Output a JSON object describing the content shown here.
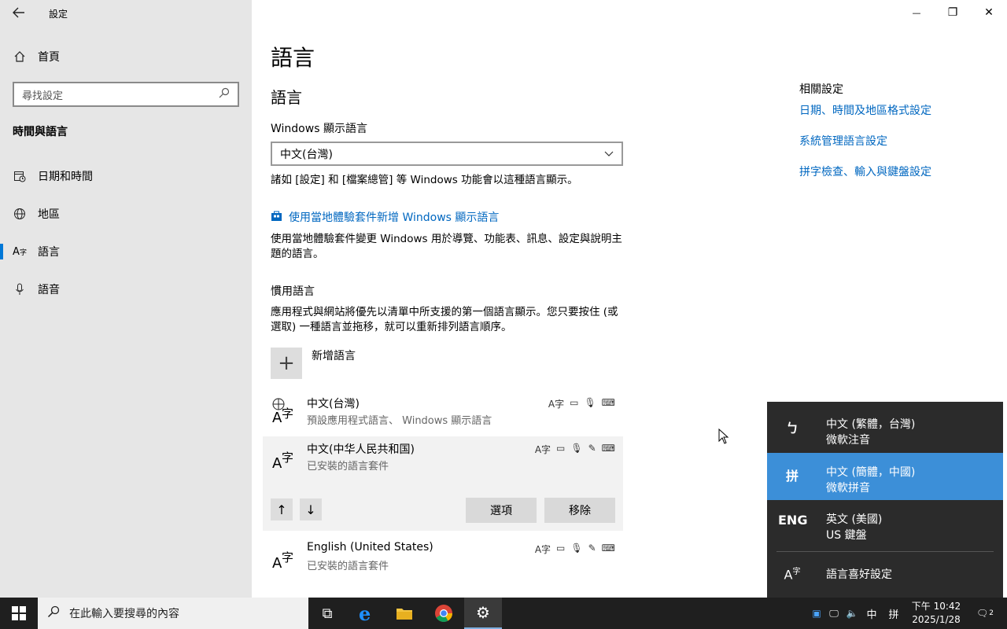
{
  "window": {
    "title": "設定",
    "minimize": "—",
    "restore": "❐",
    "close": "✕"
  },
  "sidebar": {
    "home_label": "首頁",
    "search_placeholder": "尋找設定",
    "section_title": "時間與語言",
    "items": [
      {
        "label": "日期和時間",
        "icon": "calendar-clock-icon"
      },
      {
        "label": "地區",
        "icon": "globe-icon"
      },
      {
        "label": "語言",
        "icon": "language-icon",
        "active": true
      },
      {
        "label": "語音",
        "icon": "microphone-icon"
      }
    ]
  },
  "main": {
    "page_title": "語言",
    "section_title": "語言",
    "display_lang_label": "Windows 顯示語言",
    "display_lang_value": "中文(台灣)",
    "display_lang_note": "諸如 [設定] 和 [檔案總管] 等 Windows 功能會以這種語言顯示。",
    "add_pack_link": "使用當地體驗套件新增 Windows 顯示語言",
    "add_pack_desc": "使用當地體驗套件變更 Windows 用於導覽、功能表、訊息、設定與說明主題的語言。",
    "preferred_title": "慣用語言",
    "preferred_desc": "應用程式與網站將優先以清單中所支援的第一個語言顯示。您只要按住 (或選取) 一種語言並拖移，就可以重新排列語言順序。",
    "add_language": "新增語言",
    "languages": [
      {
        "name": "中文(台灣)",
        "desc": "預設應用程式語言、 Windows 顯示語言"
      },
      {
        "name": "中文(中华人民共和国)",
        "desc": "已安裝的語言套件"
      },
      {
        "name": "English (United States)",
        "desc": "已安裝的語言套件"
      }
    ],
    "options_button": "選項",
    "remove_button": "移除"
  },
  "related": {
    "title": "相關設定",
    "links": [
      "日期、時間及地區格式設定",
      "系統管理語言設定",
      "拼字檢查、輸入與鍵盤設定"
    ]
  },
  "ime_popup": {
    "items": [
      {
        "key": "ㄅ",
        "line1": "中文 (繁體，台灣)",
        "line2": "微軟注音"
      },
      {
        "key": "拼",
        "line1": "中文 (簡體，中國)",
        "line2": "微軟拼音",
        "selected": true
      },
      {
        "key": "ENG",
        "line1": "英文 (美國)",
        "line2": "US 鍵盤"
      }
    ],
    "prefs": "語言喜好設定"
  },
  "taskbar": {
    "search_placeholder": "在此輸入要搜尋的內容",
    "ime_indicator": "中",
    "ime_mode": "拼",
    "time": "下午 10:42",
    "date": "2025/1/28",
    "notification_count": "2"
  },
  "colors": {
    "accent": "#0078d7",
    "link": "#0067c0",
    "sidebar_bg": "#e6e6e6",
    "ime_selected": "#3c8fd8"
  }
}
